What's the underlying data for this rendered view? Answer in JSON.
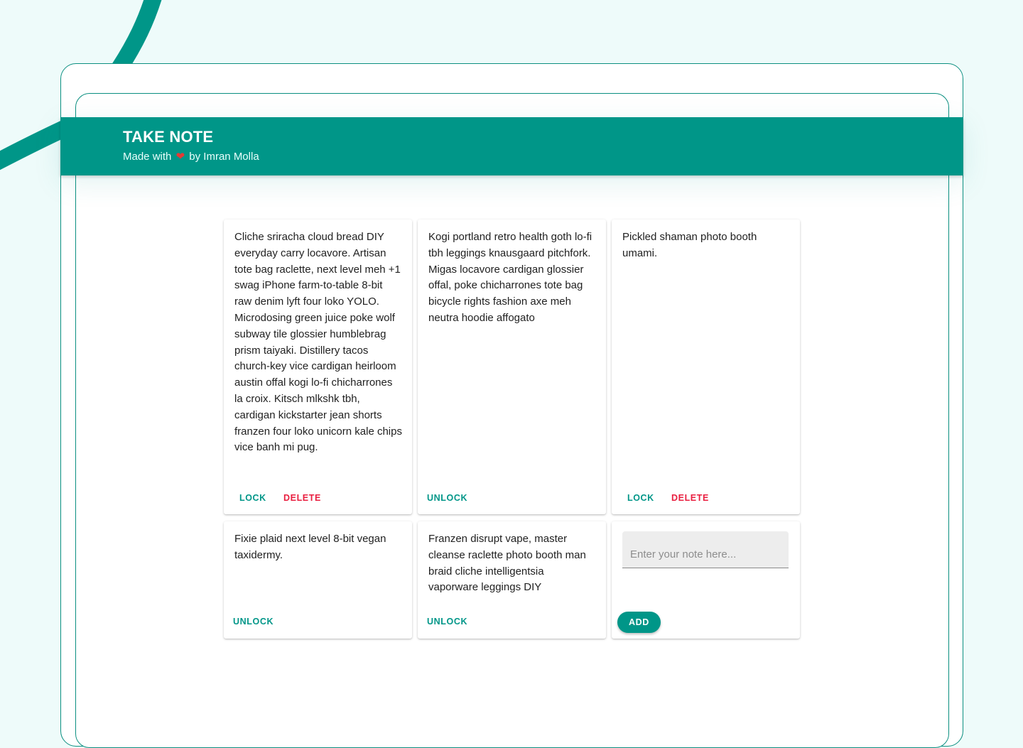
{
  "header": {
    "title": "TAKE NOTE",
    "subtitle_prefix": "Made with",
    "heart_icon": "❤",
    "subtitle_suffix": "by Imran Molla"
  },
  "notes": [
    {
      "text": "Cliche sriracha cloud bread DIY everyday carry locavore. Artisan tote bag raclette, next level meh +1 swag iPhone farm-to-table 8-bit raw denim lyft four loko YOLO. Microdosing green juice poke wolf subway tile glossier humblebrag prism taiyaki. Distillery tacos church-key vice cardigan heirloom austin offal kogi lo-fi chicharrones la croix. Kitsch mlkshk tbh, cardigan kickstarter jean shorts franzen four loko unicorn kale chips vice banh mi pug.",
      "lock_label": "LOCK",
      "delete_label": "DELETE"
    },
    {
      "text": "Kogi portland retro health goth lo-fi tbh leggings knausgaard pitchfork. Migas locavore cardigan glossier offal, poke chicharrones tote bag bicycle rights fashion axe meh neutra hoodie affogato",
      "unlock_label": "UNLOCK"
    },
    {
      "text": "Pickled shaman photo booth umami.",
      "lock_label": "LOCK",
      "delete_label": "DELETE"
    },
    {
      "text": "Fixie plaid next level 8-bit vegan taxidermy.",
      "unlock_label": "UNLOCK"
    },
    {
      "text": "Franzen disrupt vape, master cleanse raclette photo booth man braid cliche intelligentsia vaporware leggings DIY",
      "unlock_label": "UNLOCK"
    }
  ],
  "new_note": {
    "placeholder": "Enter your note here...",
    "value": "",
    "add_label": "ADD"
  },
  "colors": {
    "primary": "#009688",
    "danger": "#e91e3f",
    "background": "#eefbfa",
    "heart": "#e53935"
  }
}
